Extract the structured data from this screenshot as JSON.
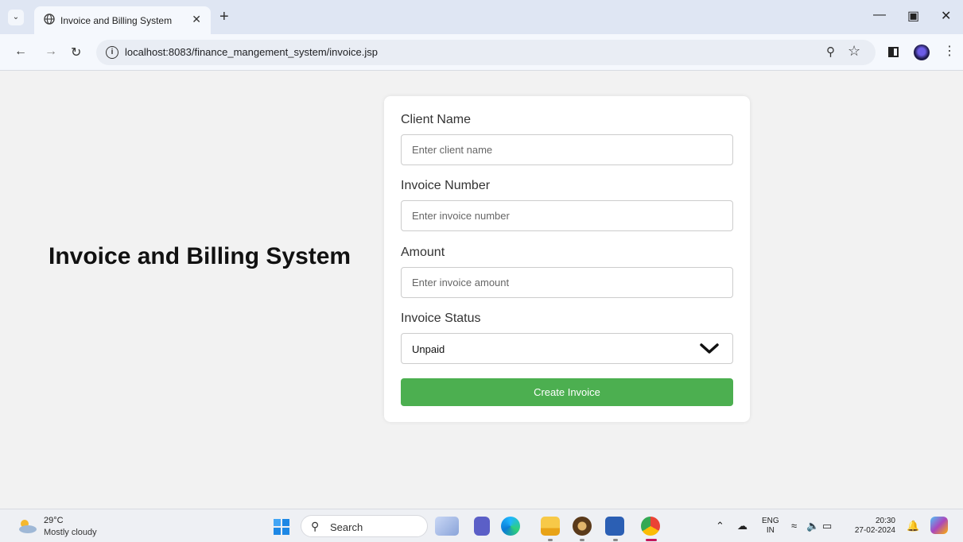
{
  "browser": {
    "tab_title": "Invoice and Billing System",
    "url": "localhost:8083/finance_mangement_system/invoice.jsp"
  },
  "page": {
    "title": "Invoice and Billing System",
    "form": {
      "client_name_label": "Client Name",
      "client_name_placeholder": "Enter client name",
      "invoice_number_label": "Invoice Number",
      "invoice_number_placeholder": "Enter invoice number",
      "amount_label": "Amount",
      "amount_placeholder": "Enter invoice amount",
      "status_label": "Invoice Status",
      "status_value": "Unpaid",
      "submit_label": "Create Invoice"
    }
  },
  "taskbar": {
    "temperature": "29°C",
    "weather": "Mostly cloudy",
    "search": "Search",
    "lang_line1": "ENG",
    "lang_line2": "IN",
    "time": "20:30",
    "date": "27-02-2024"
  },
  "colors": {
    "button_green": "#4caf50",
    "page_background": "#f2f2f2",
    "chrome_tab_strip": "#dfe6f3"
  }
}
